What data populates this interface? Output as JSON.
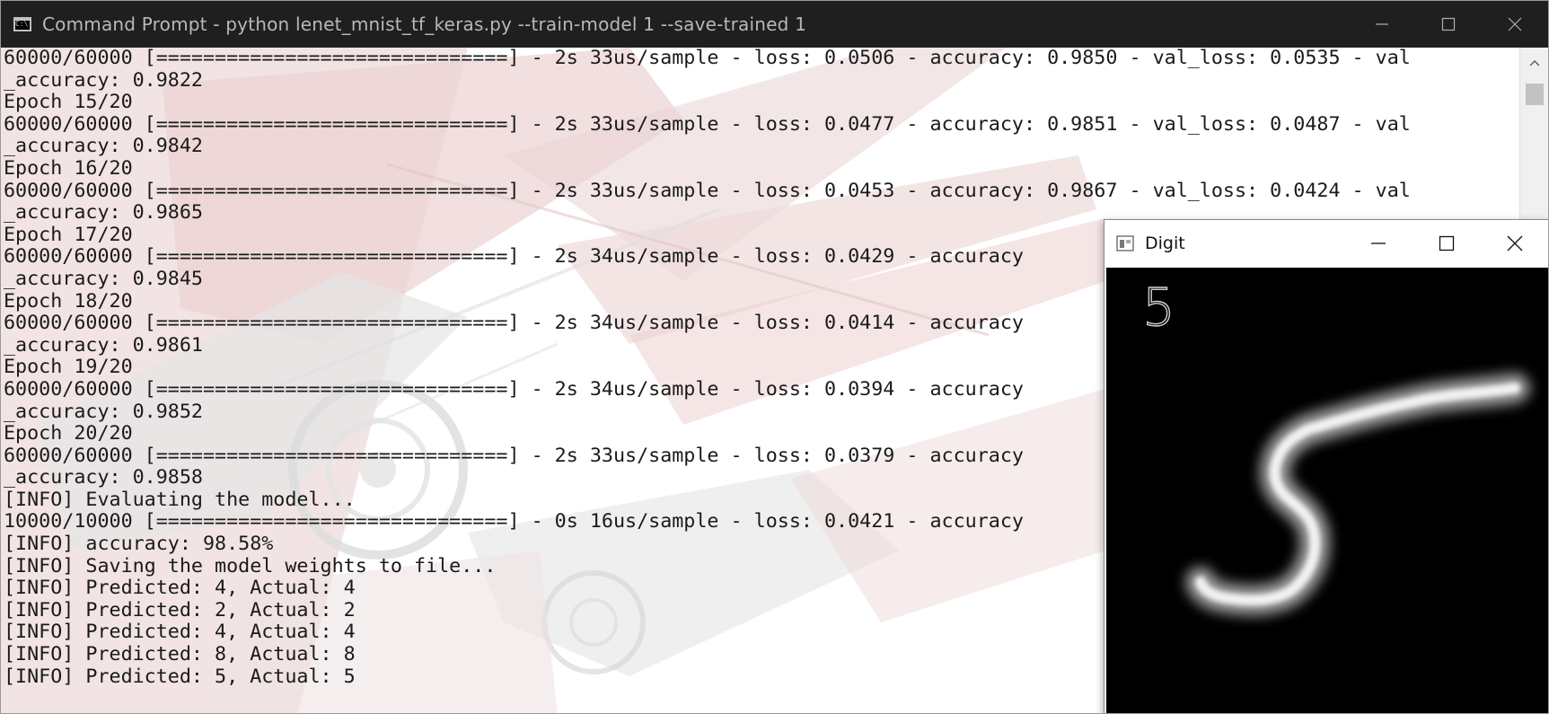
{
  "console_window": {
    "title": "Command Prompt - python  lenet_mnist_tf_keras.py --train-model 1 --save-trained 1",
    "icon": "cmd-icon",
    "icon_text": "C:\\."
  },
  "console": {
    "lines": [
      "60000/60000 [==============================] - 2s 33us/sample - loss: 0.0506 - accuracy: 0.9850 - val_loss: 0.0535 - val",
      "_accuracy: 0.9822",
      "Epoch 15/20",
      "60000/60000 [==============================] - 2s 33us/sample - loss: 0.0477 - accuracy: 0.9851 - val_loss: 0.0487 - val",
      "_accuracy: 0.9842",
      "Epoch 16/20",
      "60000/60000 [==============================] - 2s 33us/sample - loss: 0.0453 - accuracy: 0.9867 - val_loss: 0.0424 - val",
      "_accuracy: 0.9865",
      "Epoch 17/20",
      "60000/60000 [==============================] - 2s 34us/sample - loss: 0.0429 - accuracy",
      "_accuracy: 0.9845",
      "Epoch 18/20",
      "60000/60000 [==============================] - 2s 34us/sample - loss: 0.0414 - accuracy",
      "_accuracy: 0.9861",
      "Epoch 19/20",
      "60000/60000 [==============================] - 2s 34us/sample - loss: 0.0394 - accuracy",
      "_accuracy: 0.9852",
      "Epoch 20/20",
      "60000/60000 [==============================] - 2s 33us/sample - loss: 0.0379 - accuracy",
      "_accuracy: 0.9858",
      "[INFO] Evaluating the model...",
      "10000/10000 [==============================] - 0s 16us/sample - loss: 0.0421 - accuracy",
      "[INFO] accuracy: 98.58%",
      "[INFO] Saving the model weights to file...",
      "[INFO] Predicted: 4, Actual: 4",
      "[INFO] Predicted: 2, Actual: 2",
      "[INFO] Predicted: 4, Actual: 4",
      "[INFO] Predicted: 8, Actual: 8",
      "[INFO] Predicted: 5, Actual: 5"
    ]
  },
  "digit_window": {
    "title": "Digit",
    "predicted_label": "5",
    "icon": "image-window-icon"
  },
  "window_controls": [
    "minimize-icon",
    "maximize-icon",
    "close-icon"
  ],
  "colors": {
    "titlebar_dark": "#1f1f1f",
    "console_text": "#1a1a1a",
    "canvas_bg": "#000000"
  }
}
